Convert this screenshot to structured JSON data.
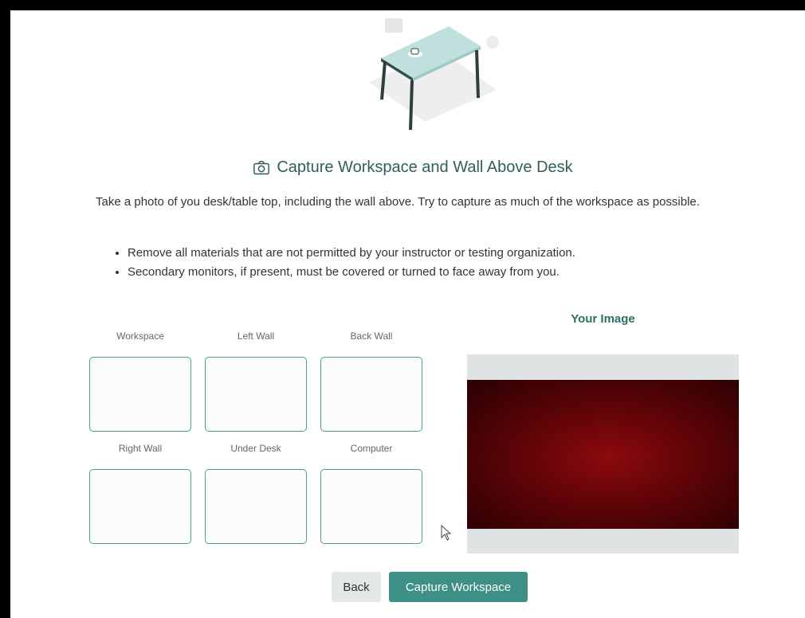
{
  "heading": {
    "icon": "camera-icon",
    "title": "Capture Workspace and Wall Above Desk"
  },
  "intro": "Take a photo of you desk/table top, including the wall above. Try to capture as much of the workspace as possible.",
  "bullets": [
    "Remove all materials that are not permitted by your instructor or testing organization.",
    "Secondary monitors, if present, must be covered or turned to face away from you."
  ],
  "slots": [
    {
      "label": "Workspace"
    },
    {
      "label": "Left Wall"
    },
    {
      "label": "Back Wall"
    },
    {
      "label": "Right Wall"
    },
    {
      "label": "Under Desk"
    },
    {
      "label": "Computer"
    }
  ],
  "image_panel": {
    "title": "Your Image"
  },
  "buttons": {
    "back": "Back",
    "capture": "Capture Workspace"
  },
  "colors": {
    "accent": "#3e8f86",
    "heading": "#2f5f5c",
    "slot_border": "#4f9d92"
  }
}
